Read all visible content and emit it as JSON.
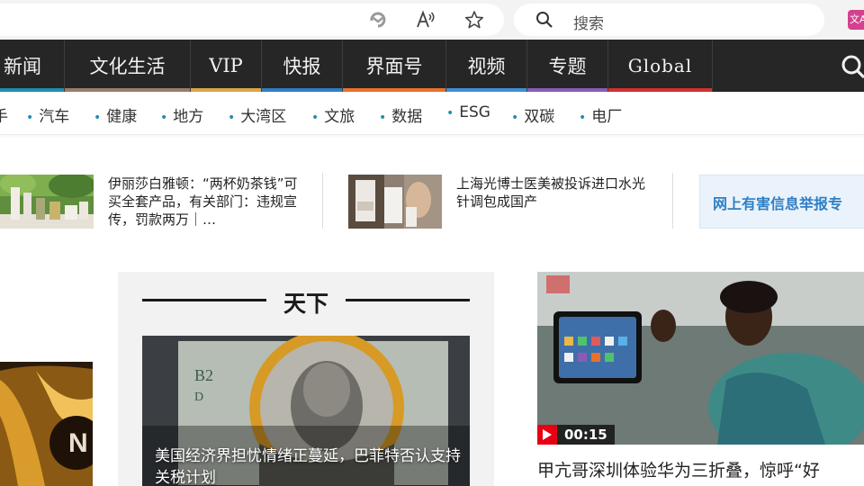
{
  "browser": {
    "search_placeholder": "搜索",
    "icons": [
      "refresh-sync-icon",
      "read-aloud-icon",
      "favorite-star-icon",
      "search-icon",
      "translate-extension-icon"
    ],
    "extension_label": "文A"
  },
  "nav": {
    "items": [
      {
        "label": "新闻",
        "color": "#1f8fb0"
      },
      {
        "label": "文化生活",
        "color": "#9a7d6a"
      },
      {
        "label": "VIP",
        "color": "#d9a74a"
      },
      {
        "label": "快报",
        "color": "#2f7fc4"
      },
      {
        "label": "界面号",
        "color": "#e8702a"
      },
      {
        "label": "视频",
        "color": "#3f8fd4"
      },
      {
        "label": "专题",
        "color": "#8a5bb5"
      },
      {
        "label": "Global",
        "color": "#d33131"
      }
    ],
    "search_icon": "search-icon"
  },
  "subnav": {
    "partial_label": "手",
    "items": [
      "汽车",
      "健康",
      "地方",
      "大湾区",
      "文旅",
      "数据",
      "ESG",
      "双碳",
      "电厂"
    ]
  },
  "headlines": [
    {
      "title": "伊丽莎白雅顿：“两杯奶茶钱”可买全套产品，有关部门：违规宣传，罚款两万｜…"
    },
    {
      "title": "上海光博士医美被投诉进口水光针调包成国产"
    }
  ],
  "report_banner": {
    "label": "网上有害信息举报专"
  },
  "tianxia": {
    "section_title": "天下",
    "article": {
      "caption": "美国经济界担忧情绪正蔓延，巴菲特否认支持关税计划"
    }
  },
  "video": {
    "duration": "00:15",
    "title": "甲亢哥深圳体验华为三折叠，惊呼“好"
  },
  "colors": {
    "nav_bg": "#262626",
    "accent_teal": "#1f8fb0",
    "video_badge": "#e60012"
  }
}
